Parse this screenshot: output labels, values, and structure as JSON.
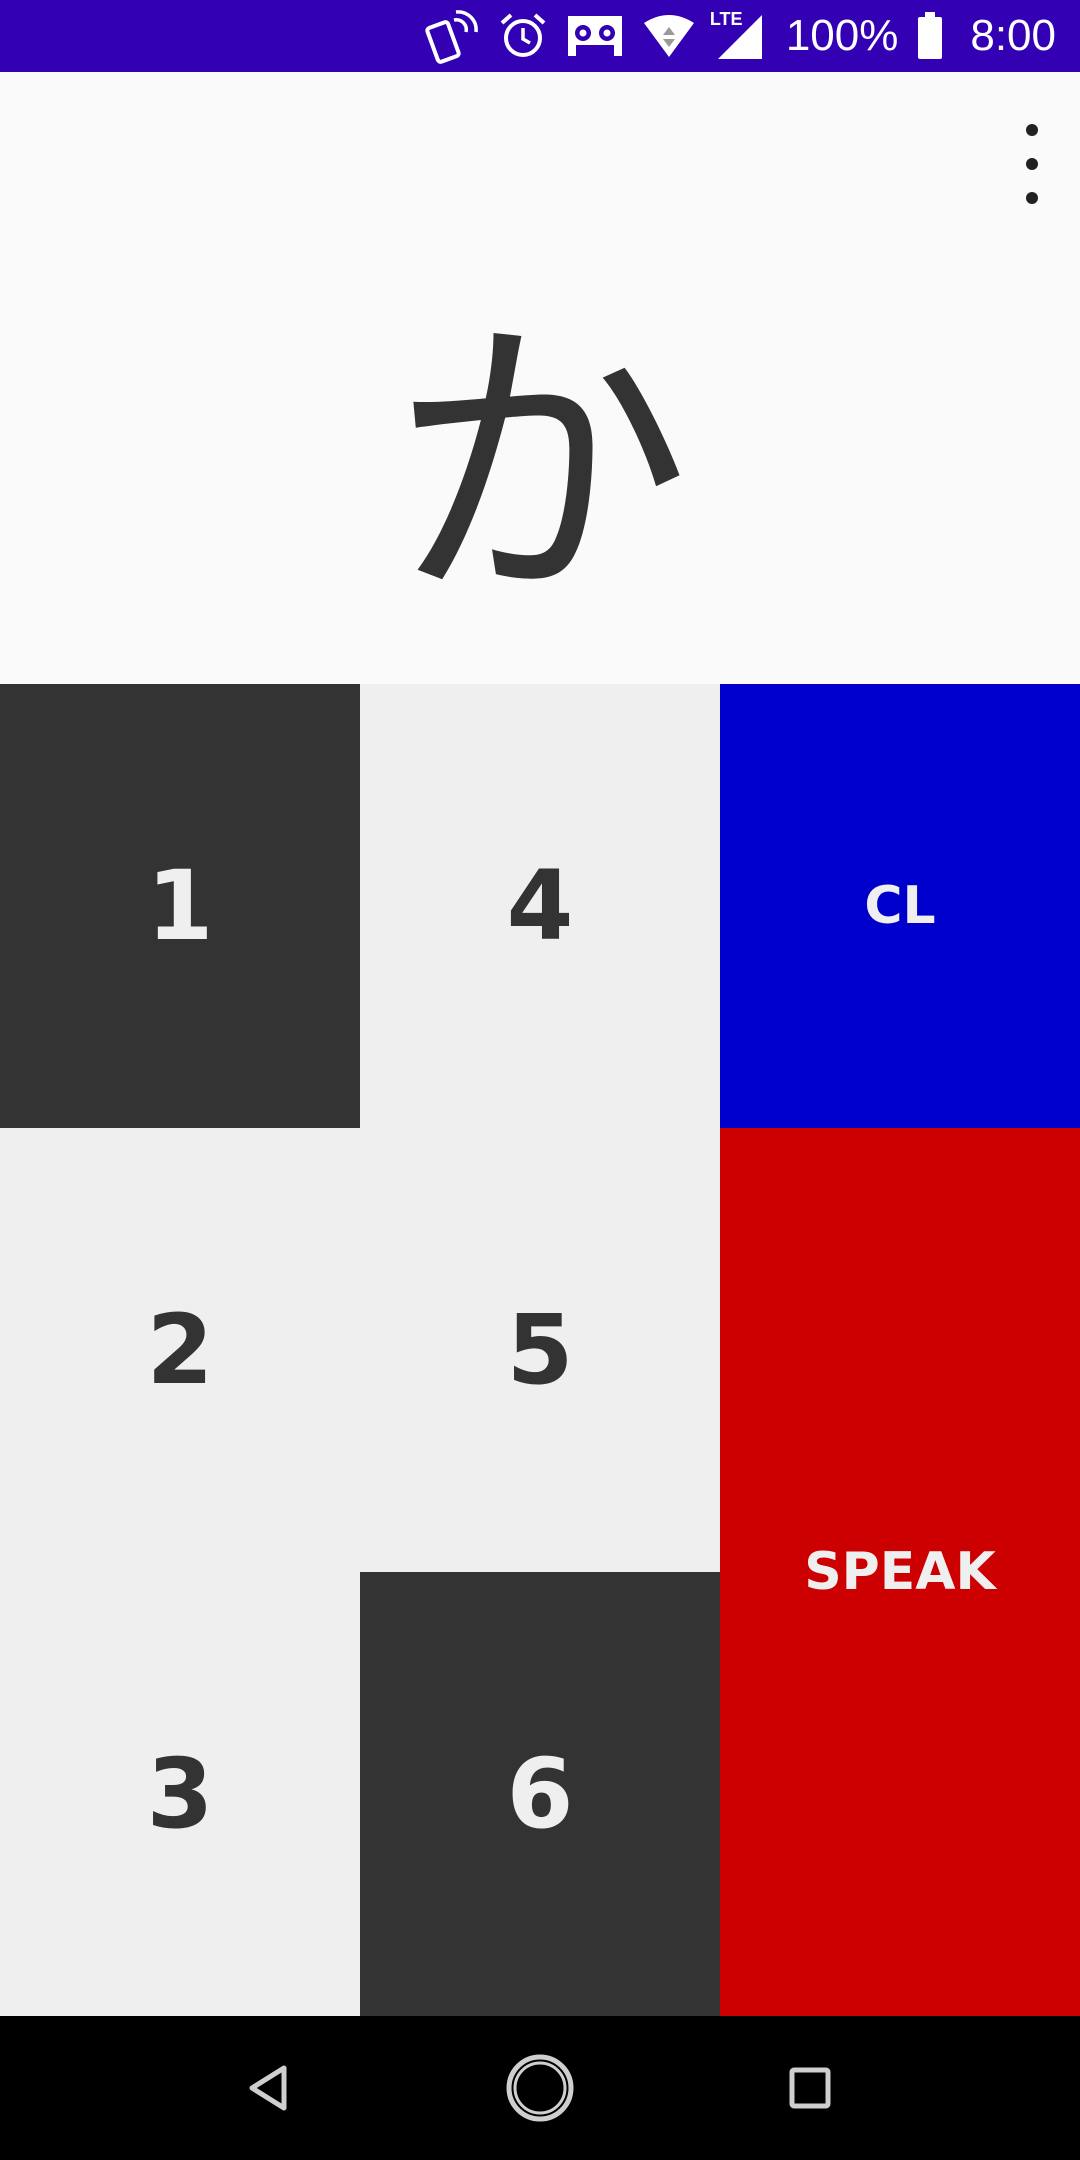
{
  "status_bar": {
    "battery_percent": "100%",
    "time": "8:00",
    "background": "#3300b3",
    "icons": [
      "phone-vibrate-icon",
      "alarm-icon",
      "voicemail-icon",
      "wifi-icon",
      "lte-signal-icon",
      "battery-icon"
    ],
    "network_label": "LTE"
  },
  "display": {
    "character": "か"
  },
  "menu": {
    "icon": "more-vert-icon"
  },
  "keypad": {
    "keys": [
      {
        "label": "1",
        "style": "dark"
      },
      {
        "label": "2",
        "style": "light"
      },
      {
        "label": "3",
        "style": "light"
      },
      {
        "label": "4",
        "style": "light"
      },
      {
        "label": "5",
        "style": "light"
      },
      {
        "label": "6",
        "style": "dark"
      }
    ],
    "clear_label": "CL",
    "speak_label": "SPEAK",
    "colors": {
      "dark": "#333333",
      "light": "#efefef",
      "clear": "#0000cc",
      "speak": "#cc0000"
    }
  },
  "nav_bar": {
    "icons": [
      "back-icon",
      "home-icon",
      "recents-icon"
    ]
  }
}
